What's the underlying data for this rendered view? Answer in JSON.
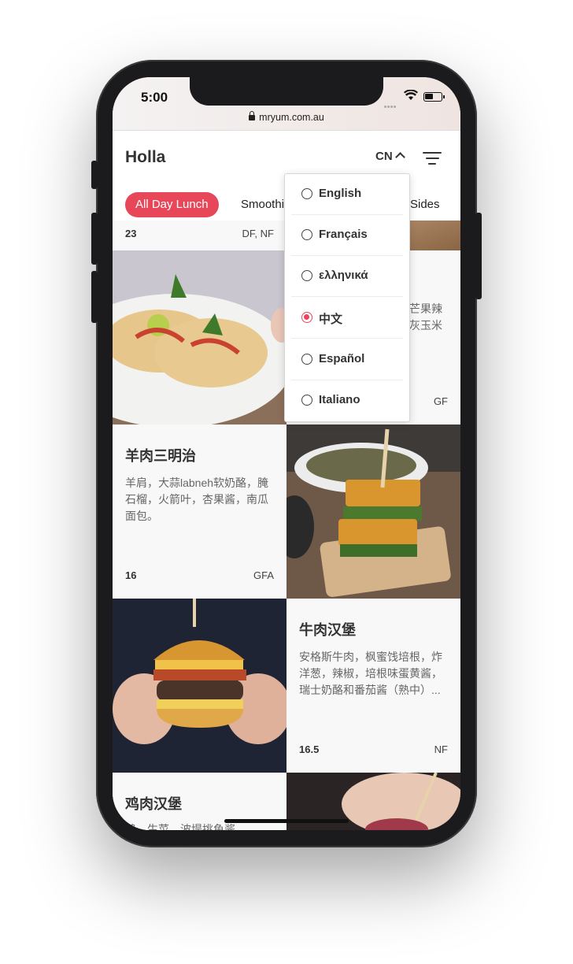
{
  "status": {
    "time": "5:00"
  },
  "browser": {
    "url": "mryum.com.au"
  },
  "header": {
    "brand": "Holla",
    "language_code": "CN"
  },
  "tabs": [
    {
      "label": "All Day Lunch",
      "active": true
    },
    {
      "label": "Smoothi",
      "active": false
    },
    {
      "label": "Sides",
      "active": false
    }
  ],
  "language_menu": {
    "options": [
      {
        "label": "English",
        "selected": false
      },
      {
        "label": "Français",
        "selected": false
      },
      {
        "label": "ελληνικά",
        "selected": false
      },
      {
        "label": "中文",
        "selected": true
      },
      {
        "label": "Español",
        "selected": false
      },
      {
        "label": "Italiano",
        "selected": false
      }
    ]
  },
  "items": {
    "partial_top_left": {
      "price": "23",
      "tags": "DF, NF"
    },
    "partial_top_right": {
      "desc_line1": "芒果辣",
      "desc_line2": "灰玉米",
      "tags": "GF"
    },
    "lamb_sandwich": {
      "title": "羊肉三明治",
      "desc": "羊肩，大蒜labneh软奶酪，腌石榴，火箭叶，杏果酱，南瓜面包。",
      "price": "16",
      "tags": "GFA"
    },
    "beef_burger": {
      "title": "牛肉汉堡",
      "desc": "安格斯牛肉，枫蜜饯培根，炸洋葱，辣椒，培根味蛋黄酱，瑞士奶酪和番茄酱（熟中）...",
      "price": "16.5",
      "tags": "NF"
    },
    "chicken_burger": {
      "title": "鸡肉汉堡",
      "desc": "鸡，生菜，波堤挑鱼酱..."
    }
  },
  "colors": {
    "accent": "#e8475a",
    "text": "#333333",
    "muted": "#666666"
  }
}
